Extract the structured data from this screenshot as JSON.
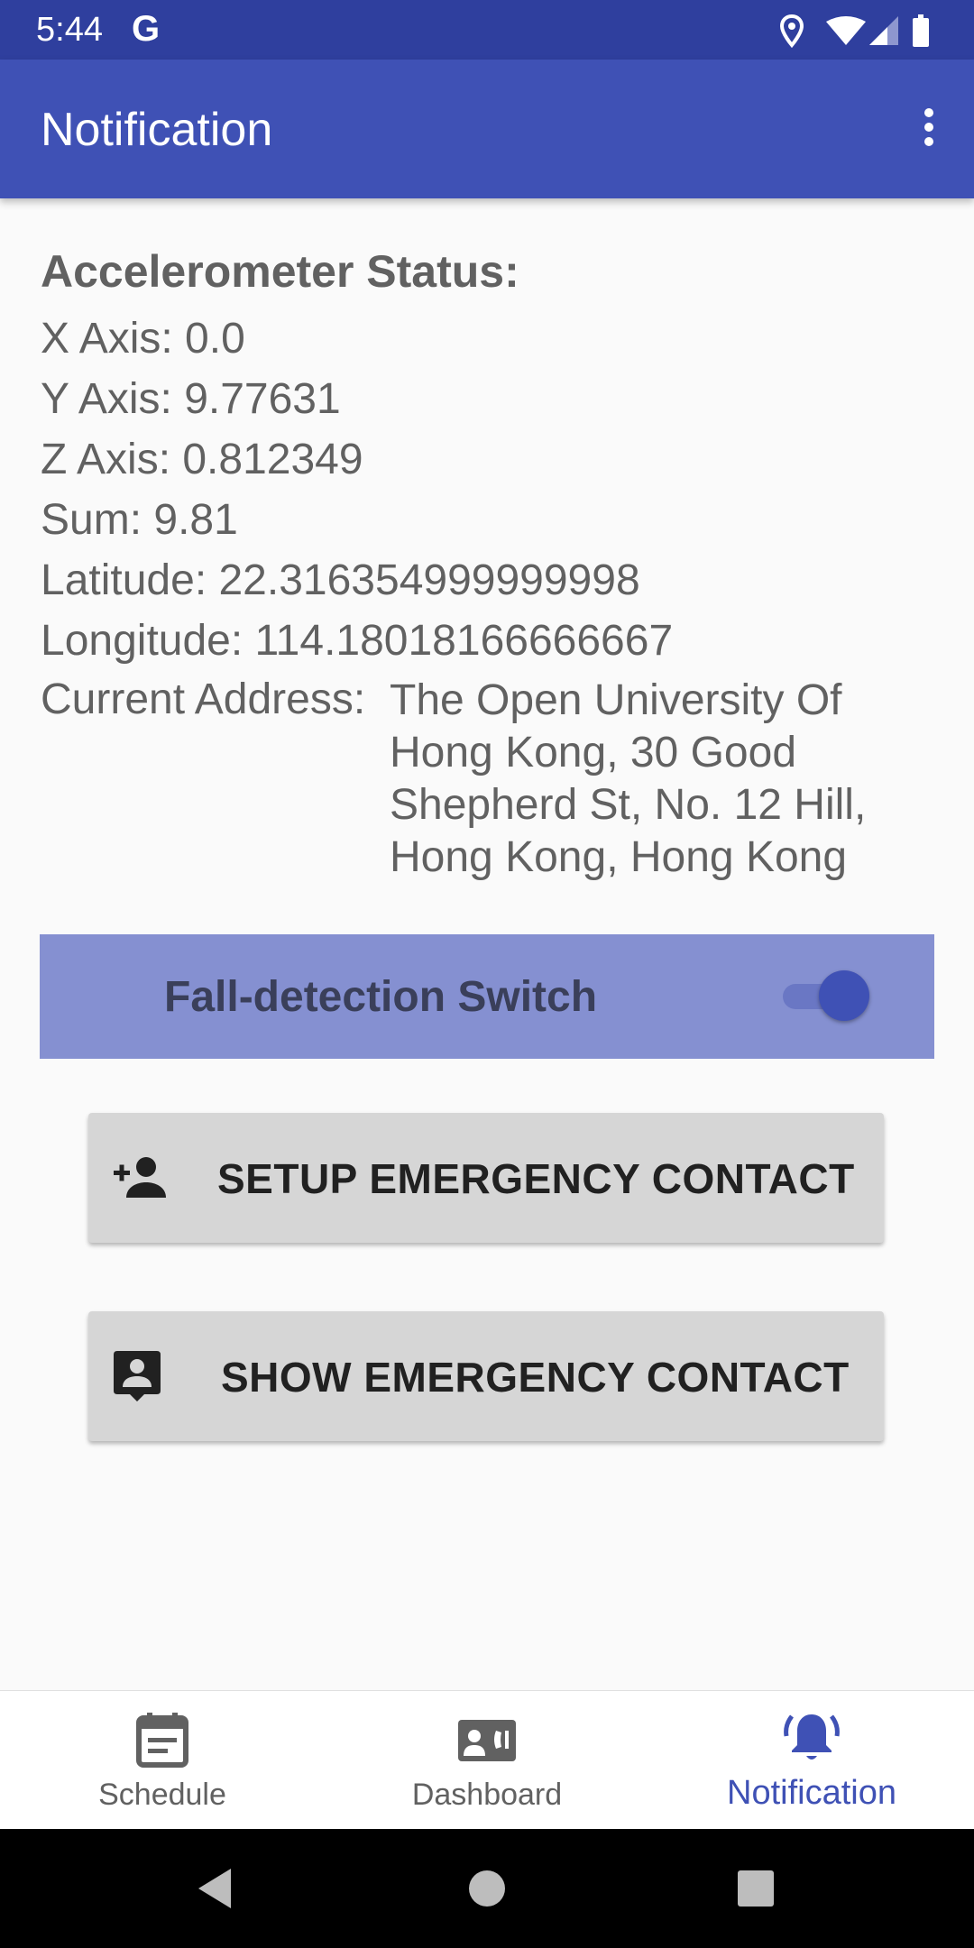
{
  "status_bar": {
    "time": "5:44",
    "google_badge": "G",
    "icons": [
      "location-icon",
      "wifi-icon",
      "cellular-signal-icon",
      "battery-icon"
    ]
  },
  "app_bar": {
    "title": "Notification",
    "menu_icon": "more-vert-icon"
  },
  "accelerometer": {
    "heading": "Accelerometer Status:",
    "x_axis": "X Axis: 0.0",
    "y_axis": "Y Axis: 9.77631",
    "z_axis": "Z Axis: 0.812349",
    "sum": "Sum: 9.81",
    "latitude": "Latitude: 22.316354999999998",
    "longitude": "Longitude: 114.18018166666667",
    "address_label": "Current Address:",
    "address_value": "The Open University Of Hong Kong, 30 Good Shepherd St, No. 12 Hill, Hong Kong, Hong Kong"
  },
  "fall_detection": {
    "label": "Fall-detection Switch",
    "enabled": true
  },
  "buttons": {
    "setup": {
      "label": "SETUP EMERGENCY CONTACT",
      "icon": "person-add-icon"
    },
    "show": {
      "label": "SHOW EMERGENCY CONTACT",
      "icon": "contact-card-icon"
    }
  },
  "bottom_nav": {
    "items": [
      {
        "label": "Schedule",
        "icon": "calendar-icon",
        "active": false
      },
      {
        "label": "Dashboard",
        "icon": "dashboard-phone-icon",
        "active": false
      },
      {
        "label": "Notification",
        "icon": "notification-bell-icon",
        "active": true
      }
    ]
  },
  "colors": {
    "status_bar": "#2f3f9e",
    "app_bar": "#3f51b5",
    "accent": "#3f51b5",
    "switch_panel": "#8590d1",
    "button_bg": "#d6d6d6",
    "text_secondary": "#616161"
  }
}
